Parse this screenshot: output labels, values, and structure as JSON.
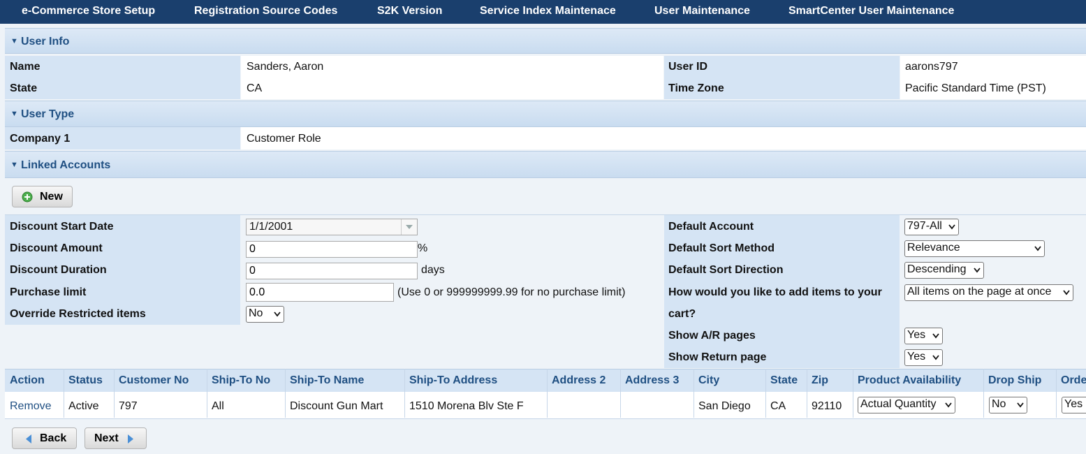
{
  "nav": [
    "e-Commerce Store Setup",
    "Registration Source Codes",
    "S2K Version",
    "Service Index Maintenace",
    "User Maintenance",
    "SmartCenter User Maintenance"
  ],
  "sections": {
    "user_info": "User Info",
    "user_type": "User Type",
    "linked_accounts": "Linked Accounts"
  },
  "user_info": {
    "name_label": "Name",
    "name_value": "Sanders, Aaron",
    "state_label": "State",
    "state_value": "CA",
    "user_id_label": "User ID",
    "user_id_value": "aarons797",
    "time_zone_label": "Time Zone",
    "time_zone_value": "Pacific Standard Time (PST)"
  },
  "user_type": {
    "company_label": "Company 1",
    "company_value": "Customer Role"
  },
  "linked": {
    "new_button": "New",
    "discount_start_label": "Discount Start Date",
    "discount_start_value": "1/1/2001",
    "discount_amount_label": "Discount Amount",
    "discount_amount_value": "0",
    "discount_amount_unit": "%",
    "discount_duration_label": "Discount Duration",
    "discount_duration_value": "0",
    "discount_duration_unit": "days",
    "purchase_limit_label": "Purchase limit",
    "purchase_limit_value": "0.0",
    "purchase_limit_hint": "(Use 0 or 999999999.99 for no purchase limit)",
    "override_label": "Override Restricted items",
    "override_value": "No",
    "default_account_label": "Default Account",
    "default_account_value": "797-All",
    "default_sort_method_label": "Default Sort Method",
    "default_sort_method_value": "Relevance",
    "default_sort_direction_label": "Default Sort Direction",
    "default_sort_direction_value": "Descending",
    "add_items_label_1": "How would you like to add items to your",
    "add_items_label_2": "cart?",
    "add_items_value": "All items on the page at once",
    "show_ar_label": "Show A/R pages",
    "show_ar_value": "Yes",
    "show_return_label": "Show Return page",
    "show_return_value": "Yes"
  },
  "table": {
    "headers": [
      "Action",
      "Status",
      "Customer No",
      "Ship-To No",
      "Ship-To Name",
      "Ship-To Address",
      "Address 2",
      "Address 3",
      "City",
      "State",
      "Zip",
      "Product Availability",
      "Drop Ship",
      "Orde"
    ],
    "row": {
      "action": "Remove",
      "status": "Active",
      "customer_no": "797",
      "ship_to_no": "All",
      "ship_to_name": "Discount Gun Mart",
      "ship_to_address": "1510 Morena Blv Ste F",
      "address2": "",
      "address3": "",
      "city": "San Diego",
      "state": "CA",
      "zip": "92110",
      "product_availability": "Actual Quantity",
      "drop_ship": "No",
      "order": "Yes"
    }
  },
  "footer": {
    "back_button": "Back",
    "next_button": "Next"
  },
  "colors": {
    "nav_bg": "#1a3f6d",
    "section_text": "#1f4f82",
    "label_bg": "#d5e4f4",
    "page_bg": "#eef3f8"
  }
}
